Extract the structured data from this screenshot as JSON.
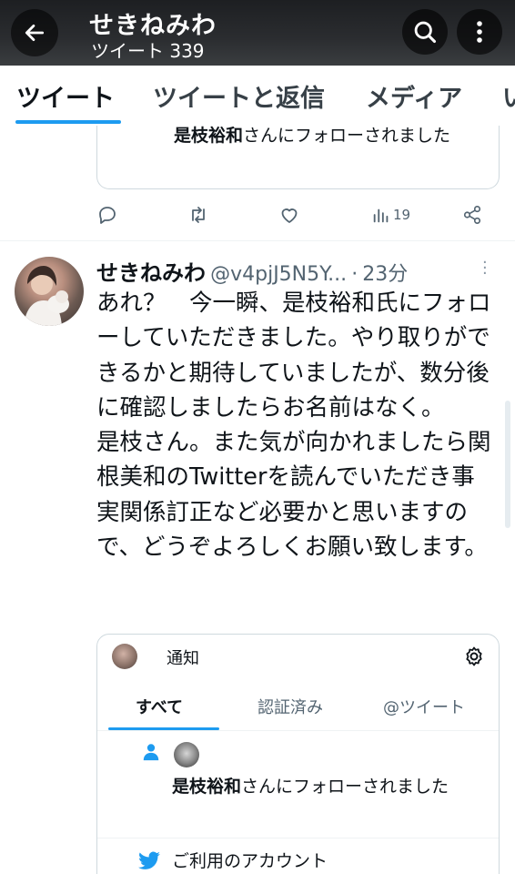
{
  "header": {
    "title": "せきねみわ",
    "subtitle": "ツイート 339"
  },
  "tabs": [
    {
      "label": "ツイート",
      "active": true
    },
    {
      "label": "ツイートと返信",
      "active": false
    },
    {
      "label": "メディア",
      "active": false
    },
    {
      "label": "い",
      "active": false
    }
  ],
  "prev_tweet": {
    "quote_text": "是枝裕和さんにフォローされました",
    "views": "19"
  },
  "tweet": {
    "author": "せきねみわ",
    "handle": "@v4pjJ5N5Y...",
    "time": "23分",
    "body": "あれ？　今一瞬、是枝裕和氏にフォローしていただきました。やり取りができるかと期待していましたが、数分後に確認しましたらお名前はなく。\n是枝さん。また気が向かれましたら関根美和のTwitterを読んでいただき事実関係訂正など必要かと思いますので、どうぞよろしくお願い致します。"
  },
  "embedded": {
    "title": "通知",
    "tabs": [
      {
        "label": "すべて",
        "active": true
      },
      {
        "label": "認証済み",
        "active": false
      },
      {
        "label": "@ツイート",
        "active": false
      }
    ],
    "notification_text_bold": "是枝裕和",
    "notification_text_rest": "さんにフォローされました",
    "second_item": "ご利用のアカウント"
  },
  "colors": {
    "accent": "#1d9bf0",
    "text": "#0f1419",
    "muted": "#536471"
  },
  "icons": [
    "back-arrow-icon",
    "search-icon",
    "more-vertical-icon",
    "reply-icon",
    "retweet-icon",
    "like-icon",
    "views-icon",
    "share-icon",
    "more-horizontal-icon",
    "gear-icon",
    "person-icon",
    "twitter-bird-icon"
  ]
}
